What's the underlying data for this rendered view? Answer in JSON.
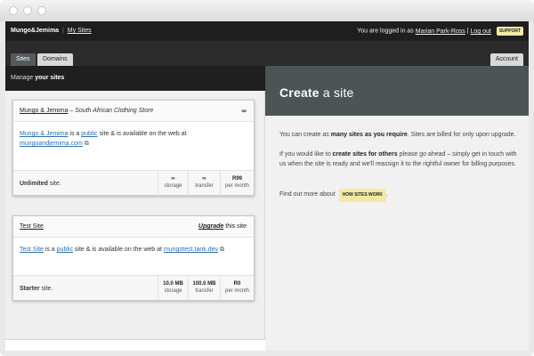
{
  "topbar": {
    "brand": "Mungo&Jemima",
    "separator": "|",
    "my_sites_link": "My Sites",
    "logged_in_prefix": "You are logged in as",
    "user_name": "Marian Park-Ross",
    "user_sep": "|",
    "logout_link": "Log out",
    "support_label": "SUPPORT"
  },
  "tabs": {
    "sites": "Sites",
    "domains": "Domains",
    "account": "Account"
  },
  "manage": {
    "prefix": "Manage",
    "bold": "your sites"
  },
  "sites": [
    {
      "title": "Mungo & Jemima",
      "tagline": " – South African Clothing Store",
      "head_right": "∞",
      "body_name": "Mungo & Jemima",
      "body_is": " is a ",
      "body_public": "public",
      "body_rest": " site & is available on the web at ",
      "body_url": "mungoandjemima.com",
      "plan_bold": "Unlimited",
      "plan_rest": " site.",
      "storage_value": "∞",
      "storage_label": "storage",
      "transfer_value": "∞",
      "transfer_label": "transfer",
      "price_value": "R99",
      "price_label": "per month"
    },
    {
      "title": "Test Site",
      "upgrade_bold": "Upgrade",
      "upgrade_rest": " this site",
      "body_name": "Test Site",
      "body_is": " is a ",
      "body_public": "public",
      "body_rest": " site & is available on the web at ",
      "body_url": "mungotest.tank.dev",
      "plan_bold": "Starter",
      "plan_rest": " site.",
      "storage_value": "10.0 MB",
      "storage_label": "storage",
      "transfer_value": "100.0 MB",
      "transfer_label": "transfer",
      "price_value": "R0",
      "price_label": "per month"
    }
  ],
  "create": {
    "heading_bold": "Create",
    "heading_rest": " a site",
    "p1_a": "You can create as ",
    "p1_bold": "many sites as you require",
    "p1_b": ". Sites are billed for only upon upgrade.",
    "p2_a": "If you would like to ",
    "p2_bold": "create sites for others",
    "p2_b": " please go ahead – simply get in touch with us when the site is ready and we'll reassign it to the rightful owner for billing purposes.",
    "more_prefix": "Find out more about",
    "how_sites_work": "HOW SITES WORK",
    "more_suffix": "."
  },
  "colors": {
    "dark_bar": "#1e1e1e",
    "header_slate": "#4c5456",
    "link_blue": "#2a6fb0",
    "badge_yellow": "#f3e9a5"
  },
  "icons": {
    "external_link": "external-link-icon"
  }
}
